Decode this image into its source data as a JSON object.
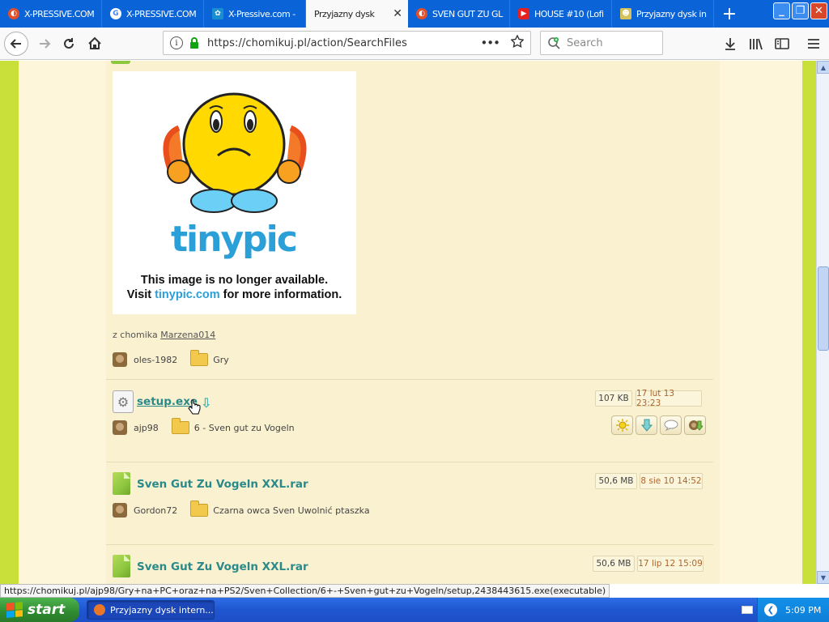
{
  "browser": {
    "tabs": [
      {
        "title": "X-PRESSIVE.COM",
        "favicon": "xpressive-favicon",
        "active": false
      },
      {
        "title": "X-PRESSIVE.COM",
        "favicon": "google-favicon",
        "active": false
      },
      {
        "title": "X-Pressive.com -",
        "favicon": "globe-favicon",
        "active": false
      },
      {
        "title": "Przyjazny dysk",
        "favicon": "none",
        "active": true
      },
      {
        "title": "SVEN GUT ZU GL",
        "favicon": "xpressive-favicon",
        "active": false
      },
      {
        "title": "HOUSE #10 (Lofi",
        "favicon": "youtube-favicon",
        "active": false
      },
      {
        "title": "Przyjazny dysk in",
        "favicon": "chomikuj-favicon",
        "active": false
      }
    ],
    "new_tab_label": "+",
    "url": "https://chomikuj.pl/action/SearchFiles",
    "page_actions_label": "•••",
    "search_placeholder": "Search"
  },
  "page": {
    "image_alt_line1": "This image is no longer available.",
    "image_alt_line2_prefix": "Visit ",
    "image_alt_link": "tinypic.com",
    "image_alt_line2_suffix": " for more information.",
    "tinypic_logo": "tinypic",
    "owner_prefix": "z chomika ",
    "owner_name": "Marzena014",
    "first_meta": {
      "user": "oles-1982",
      "folder": "Gry"
    },
    "files": [
      {
        "name": "setup.exe",
        "size": "107 KB",
        "date": "17 lut 13 23:23",
        "user": "ajp98",
        "folder": "6 - Sven gut zu Vogeln",
        "icon": "gear-icon"
      },
      {
        "name": "Sven Gut Zu Vogeln XXL.rar",
        "size": "50,6 MB",
        "date": "8 sie 10 14:52",
        "user": "Gordon72",
        "folder": "Czarna owca Sven Uwolnić ptaszka",
        "icon": "rar-file-icon"
      },
      {
        "name": "Sven Gut Zu Vogeln XXL.rar",
        "size": "50,6 MB",
        "date": "17 lip 12 15:09",
        "icon": "rar-file-icon"
      }
    ]
  },
  "status_url": "https://chomikuj.pl/ajp98/Gry+na+PC+oraz+na+PS2/Sven+Collection/6+-+Sven+gut+zu+Vogeln/setup,2438443615.exe(executable)",
  "taskbar": {
    "start_label": "start",
    "task_item": "Przyjazny dysk intern...",
    "clock": "5:09 PM"
  },
  "colors": {
    "accent_green": "#c9e03a",
    "link_teal": "#2a8a8a",
    "date_orange": "#b0652a",
    "taskbar_blue": "#1f56d0"
  }
}
